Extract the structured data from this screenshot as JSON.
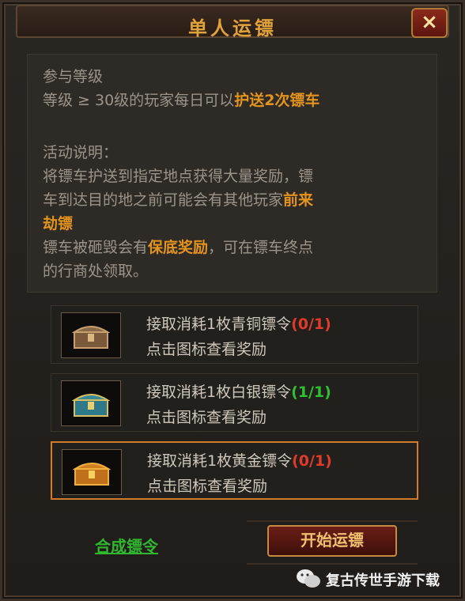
{
  "title": "单人运镖",
  "close_label": "×",
  "info": {
    "level_heading": "参与等级",
    "level_prefix": "等级 ≥ 30级的玩家每日可以",
    "level_highlight": "护送2次镖车",
    "desc_heading": "活动说明：",
    "desc1_a": "将镖车护送到指定地点获得大量奖励，镖",
    "desc1_b": "车到达目的地之前可能会有其他玩家",
    "desc1_hl": "前来",
    "desc1_c": "劫镖",
    "desc2_a": "镖车被砸毁会有",
    "desc2_hl": "保底奖励",
    "desc2_b": "，可在镖车终点",
    "desc2_c": "的行商处领取。"
  },
  "tasks": [
    {
      "label": "接取消耗1枚青铜镖令",
      "progress": "(0/1)",
      "progress_color": "#e23a2a",
      "hint": "点击图标查看奖励",
      "selected": false,
      "chest": "bronze-chest-icon"
    },
    {
      "label": "接取消耗1枚白银镖令",
      "progress": "(1/1)",
      "progress_color": "#2fc02f",
      "hint": "点击图标查看奖励",
      "selected": false,
      "chest": "silver-chest-icon"
    },
    {
      "label": "接取消耗1枚黄金镖令",
      "progress": "(0/1)",
      "progress_color": "#e23a2a",
      "hint": "点击图标查看奖励",
      "selected": true,
      "chest": "gold-chest-icon"
    }
  ],
  "buttons": {
    "compose": "合成镖令",
    "start": "开始运镖"
  },
  "watermark": "复古传世手游下载",
  "colors": {
    "accent": "#e3931f",
    "progress_red": "#e23a2a",
    "progress_green": "#2fc02f",
    "compose_green": "#2fb82f"
  }
}
